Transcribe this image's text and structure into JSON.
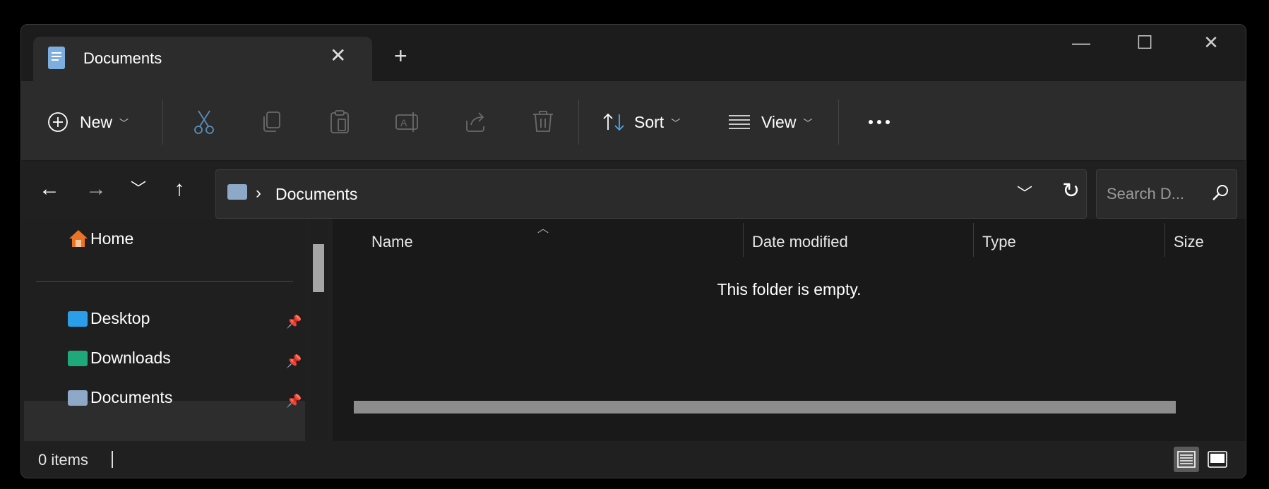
{
  "tab": {
    "title": "Documents",
    "close_icon": "close-icon",
    "new_tab_icon": "plus-icon"
  },
  "window_controls": {
    "minimize": "minimize-icon",
    "maximize": "maximize-icon",
    "close": "close-icon"
  },
  "toolbar": {
    "new_label": "New",
    "sort_label": "Sort",
    "view_label": "View",
    "more_icon": "more-icon",
    "icons": [
      "cut-icon",
      "copy-icon",
      "paste-icon",
      "rename-icon",
      "share-icon",
      "delete-icon"
    ]
  },
  "address": {
    "path": "Documents",
    "separator": "›"
  },
  "search": {
    "placeholder": "Search D..."
  },
  "sidebar": {
    "items": [
      {
        "label": "Home"
      },
      {
        "label": "Desktop"
      },
      {
        "label": "Downloads"
      },
      {
        "label": "Documents"
      }
    ]
  },
  "columns": [
    "Name",
    "Date modified",
    "Type",
    "Size"
  ],
  "content": {
    "empty_message": "This folder is empty."
  },
  "status": {
    "items_text": "0 items"
  },
  "colors": {
    "accent": "#4aa7e6",
    "background": "#202020",
    "content_bg": "#191919"
  }
}
